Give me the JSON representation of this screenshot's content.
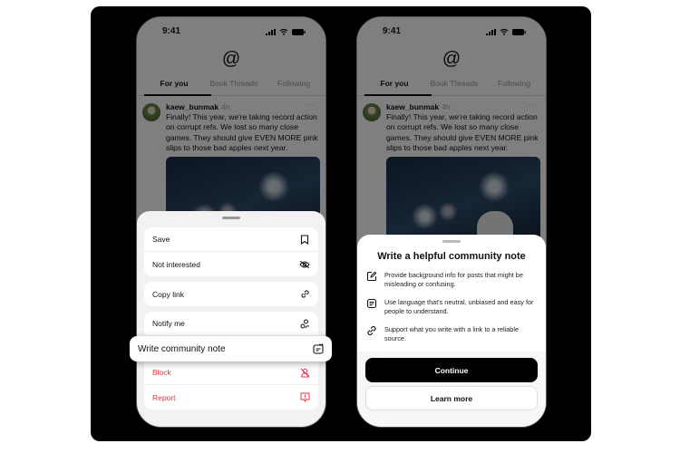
{
  "status": {
    "time": "9:41"
  },
  "tabs": [
    "For you",
    "Book Threads",
    "Following"
  ],
  "post": {
    "username": "kaew_bunmak",
    "age": "4h",
    "more": "···",
    "text": "Finally! This year, we're taking record action on corrupt refs. We lost so many close games. They should give EVEN MORE pink slips to those bad apples next year."
  },
  "menu": {
    "save": "Save",
    "not_interested": "Not interested",
    "copy_link": "Copy link",
    "notify_me": "Notify me",
    "write_note": "Write community note",
    "block": "Block",
    "report": "Report"
  },
  "note_sheet": {
    "title": "Write a helpful community note",
    "tips": [
      {
        "icon": "edit-icon",
        "text": "Provide background info for posts that might be misleading or confusing."
      },
      {
        "icon": "document-icon",
        "text": "Use language that's neutral, unbiased and easy for people to understand."
      },
      {
        "icon": "link-icon",
        "text": "Support what you write with a link to a reliable source."
      }
    ],
    "continue": "Continue",
    "learn_more": "Learn more"
  },
  "colors": {
    "danger": "#e8334a",
    "primary_button": "#000000"
  }
}
